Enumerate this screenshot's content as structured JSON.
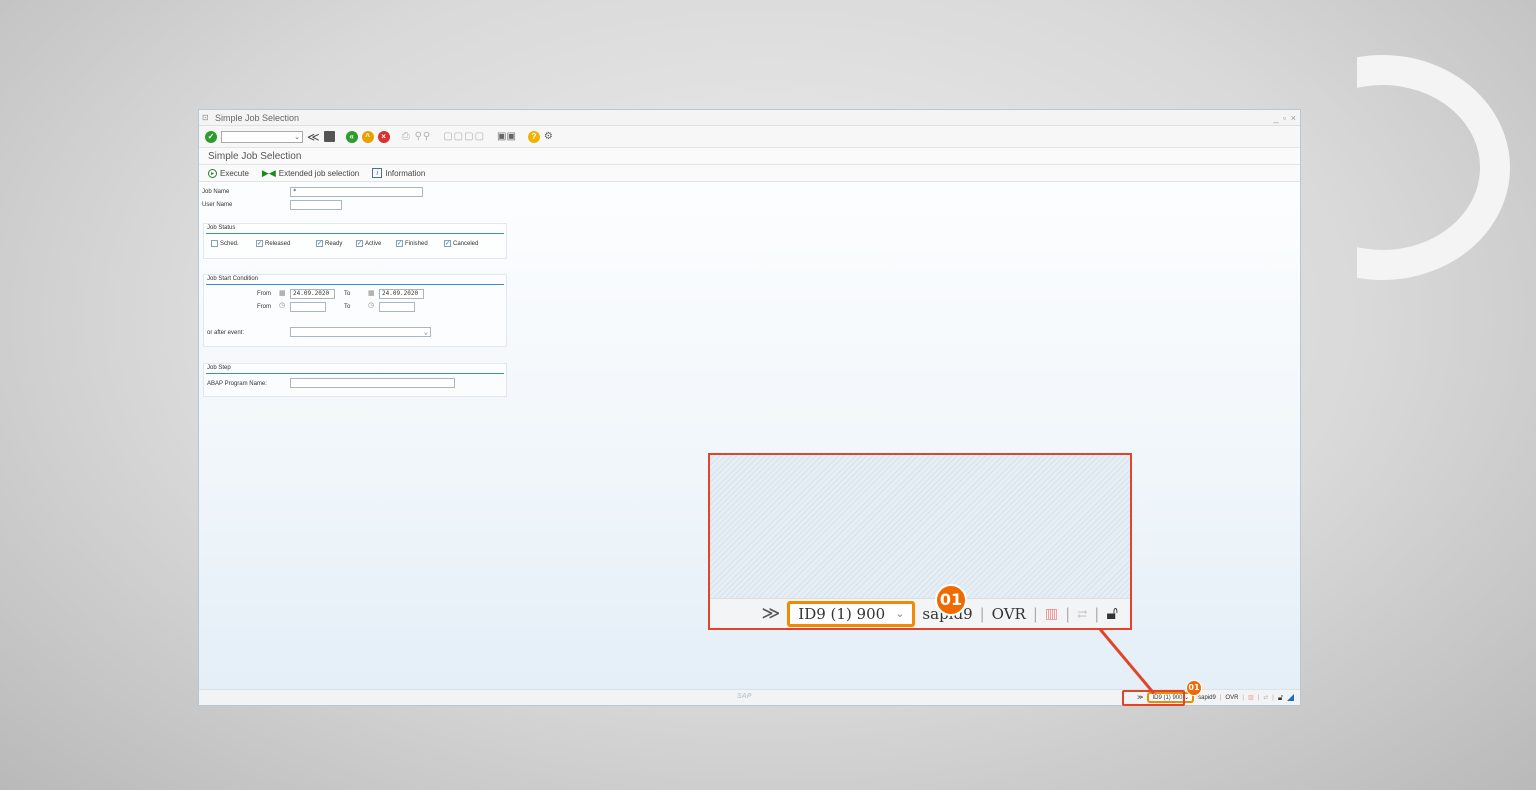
{
  "window": {
    "title": "Simple Job Selection",
    "controls": "_ ▫ ×"
  },
  "toolbar": {
    "command_field_value": "",
    "icons": [
      "enter-icon",
      "back-icon",
      "save-icon",
      "back-green-icon",
      "exit-icon",
      "cancel-icon",
      "print-icon",
      "find-icon",
      "find-next-icon",
      "first-page-icon",
      "prev-page-icon",
      "next-page-icon",
      "last-page-icon",
      "new-session-icon",
      "shortcut-icon",
      "help-icon",
      "customize-icon"
    ]
  },
  "screen": {
    "title": "Simple Job Selection"
  },
  "app_toolbar": {
    "execute": "Execute",
    "extended": "Extended job selection",
    "information": "Information"
  },
  "form": {
    "job_name_label": "Job Name",
    "job_name_value": "*",
    "user_name_label": "User Name",
    "user_name_value": "",
    "job_status": {
      "title": "Job Status",
      "items": [
        {
          "label": "Sched.",
          "checked": false
        },
        {
          "label": "Released",
          "checked": true
        },
        {
          "label": "Ready",
          "checked": true
        },
        {
          "label": "Active",
          "checked": true
        },
        {
          "label": "Finished",
          "checked": true
        },
        {
          "label": "Canceled",
          "checked": true
        }
      ]
    },
    "start_condition": {
      "title": "Job Start Condition",
      "from_label": "From",
      "to_label": "To",
      "date_from": "24.09.2020",
      "date_to": "24.09.2020",
      "time_from": "",
      "time_to": "",
      "after_event_label": "or after event:",
      "after_event_value": ""
    },
    "job_step": {
      "title": "Job Step",
      "abap_label": "ABAP Program Name:",
      "abap_value": ""
    }
  },
  "statusbar": {
    "chevron": "≫",
    "system": "ID9 (1) 900",
    "server": "sapid9",
    "mode": "OVR"
  },
  "callout": {
    "badge": "01",
    "system": "ID9 (1) 900",
    "server": "sapid9",
    "mode": "OVR"
  },
  "colors": {
    "accent": "#f08a00",
    "highlight": "#e0452a",
    "section_line": "#3a8fc4"
  }
}
